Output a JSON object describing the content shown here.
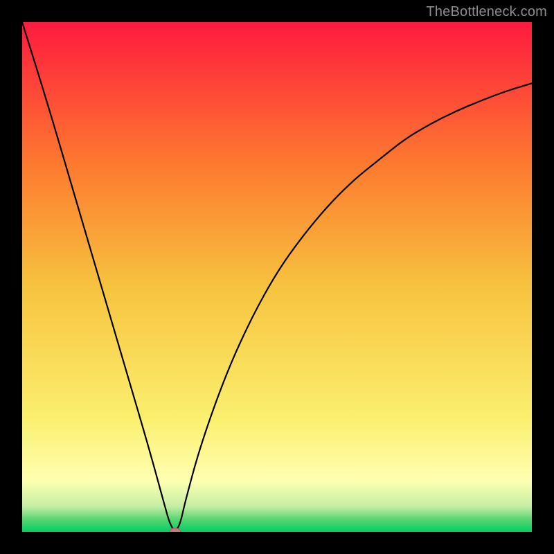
{
  "watermark": "TheBottleneck.com",
  "chart_colors": {
    "background_top": "#ff1a3f",
    "background_mid1": "#fd7a2f",
    "background_mid2": "#f7c33f",
    "background_pale_yellow": "#ffffb2",
    "background_green_light": "#c4efa4",
    "background_green_mid": "#5bd573",
    "background_green_bottom": "#00d063",
    "curve_color": "#000000",
    "marker_fill": "#c17d7b",
    "marker_stroke": "#aa5b58"
  },
  "chart_data": {
    "type": "line",
    "title": "",
    "xlabel": "",
    "ylabel": "",
    "xlim": [
      0,
      100
    ],
    "ylim": [
      0,
      100
    ],
    "series": [
      {
        "name": "bottleneck-curve",
        "x": [
          0,
          5,
          10,
          15,
          20,
          25,
          28,
          29,
          30,
          31,
          32,
          35,
          40,
          45,
          50,
          55,
          60,
          65,
          70,
          75,
          80,
          85,
          90,
          95,
          100
        ],
        "values": [
          100,
          84,
          67,
          50,
          33,
          16,
          5,
          1.5,
          0,
          1.5,
          6,
          17,
          31,
          42,
          51,
          58,
          64,
          69,
          73,
          77,
          80,
          82.5,
          84.6,
          86.5,
          88
        ]
      }
    ],
    "markers": [
      {
        "name": "min-point",
        "x": 30,
        "y": 0
      }
    ],
    "background": {
      "type": "vertical-gradient",
      "stops": [
        {
          "pos": 0,
          "color": "#ff1a3f"
        },
        {
          "pos": 0.28,
          "color": "#fd7a2f"
        },
        {
          "pos": 0.52,
          "color": "#f7c33f"
        },
        {
          "pos": 0.78,
          "color": "#fbf06f"
        },
        {
          "pos": 0.9,
          "color": "#ffffb2"
        },
        {
          "pos": 0.95,
          "color": "#c4efa4"
        },
        {
          "pos": 0.975,
          "color": "#5bd573"
        },
        {
          "pos": 1.0,
          "color": "#00d063"
        }
      ]
    }
  }
}
